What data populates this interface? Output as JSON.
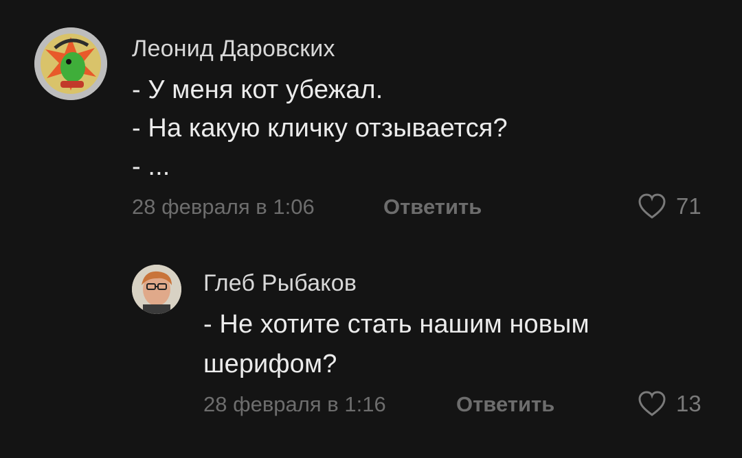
{
  "comments": [
    {
      "author": "Леонид Даровских",
      "lines": [
        "- У меня кот убежал.",
        "- На какую кличку отзывается?",
        "- ..."
      ],
      "date": "28 февраля в 1:06",
      "reply_label": "Ответить",
      "likes": "71",
      "avatar_icon": "cartoon-lizard-badge-icon"
    },
    {
      "author": "Глеб Рыбаков",
      "lines": [
        "- Не хотите стать нашим новым",
        "шерифом?"
      ],
      "date": "28 февраля в 1:16",
      "reply_label": "Ответить",
      "likes": "13",
      "avatar_icon": "person-photo-icon"
    }
  ],
  "colors": {
    "background": "#141414",
    "text": "#ececec",
    "meta": "#6d6d6d"
  }
}
